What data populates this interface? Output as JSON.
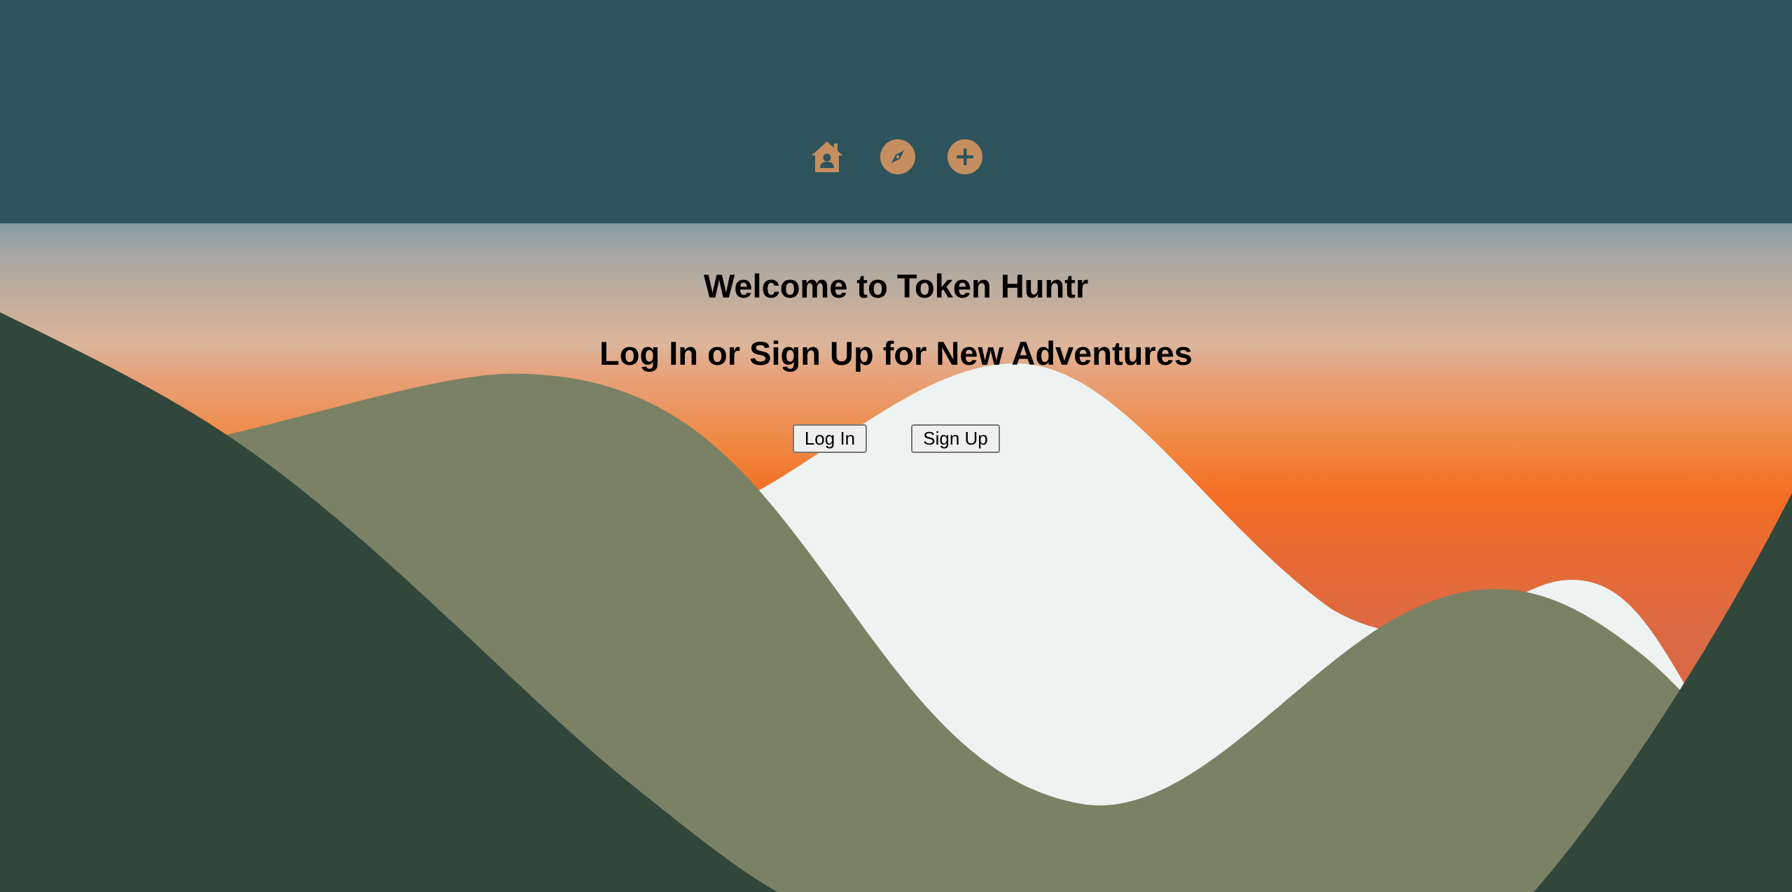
{
  "header": {
    "background_color": "#2e535d",
    "nav_icons": [
      {
        "name": "home-user-icon",
        "color": "#c58e5f"
      },
      {
        "name": "compass-icon",
        "color": "#c58e5f"
      },
      {
        "name": "plus-circle-icon",
        "color": "#c58e5f"
      }
    ]
  },
  "main": {
    "title": "Welcome to Token Huntr",
    "subtitle": "Log In or Sign Up for New Adventures",
    "login_label": "Log In",
    "signup_label": "Sign Up"
  },
  "landscape_colors": {
    "snow": "#eef3f1",
    "hills": "#7b8165",
    "foreground": "#31473c",
    "sunset": "#f46e22"
  }
}
